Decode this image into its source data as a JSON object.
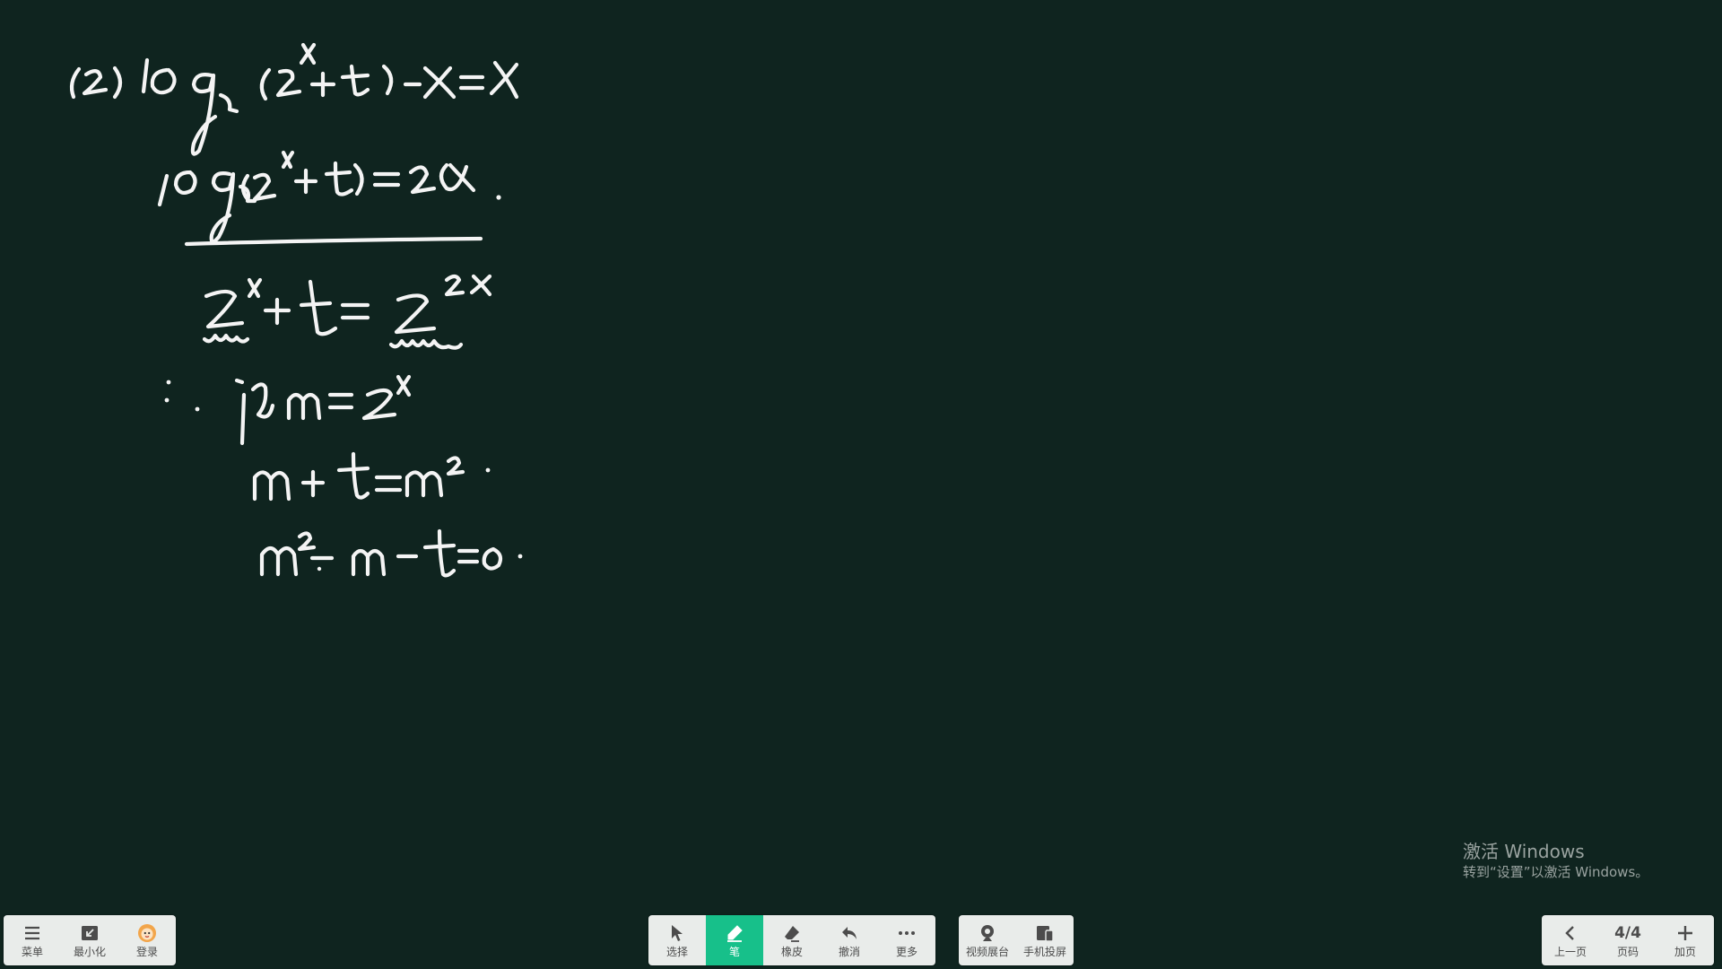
{
  "toolbar_left": [
    {
      "label": "菜单",
      "icon": "menu-icon"
    },
    {
      "label": "最小化",
      "icon": "minimize-icon"
    },
    {
      "label": "登录",
      "icon": "avatar-icon"
    }
  ],
  "toolbar_center": [
    {
      "label": "选择",
      "icon": "cursor-icon"
    },
    {
      "label": "笔",
      "icon": "pen-icon",
      "active": true
    },
    {
      "label": "橡皮",
      "icon": "eraser-icon"
    },
    {
      "label": "撤消",
      "icon": "undo-icon"
    },
    {
      "label": "更多",
      "icon": "more-icon"
    }
  ],
  "toolbar_media": [
    {
      "label": "视频展台",
      "icon": "camera-icon"
    },
    {
      "label": "手机投屏",
      "icon": "phone-cast-icon"
    }
  ],
  "toolbar_right": {
    "prev_label": "上一页",
    "page_value": "4/4",
    "page_label": "页码",
    "add_label": "加页"
  },
  "watermark": {
    "title": "激活 Windows",
    "subtitle": "转到“设置”以激活 Windows。"
  },
  "colors": {
    "board": "#0f241f",
    "ink": "#f4f4f4",
    "active": "#17c08a",
    "toolbar": "#e9ecea"
  }
}
